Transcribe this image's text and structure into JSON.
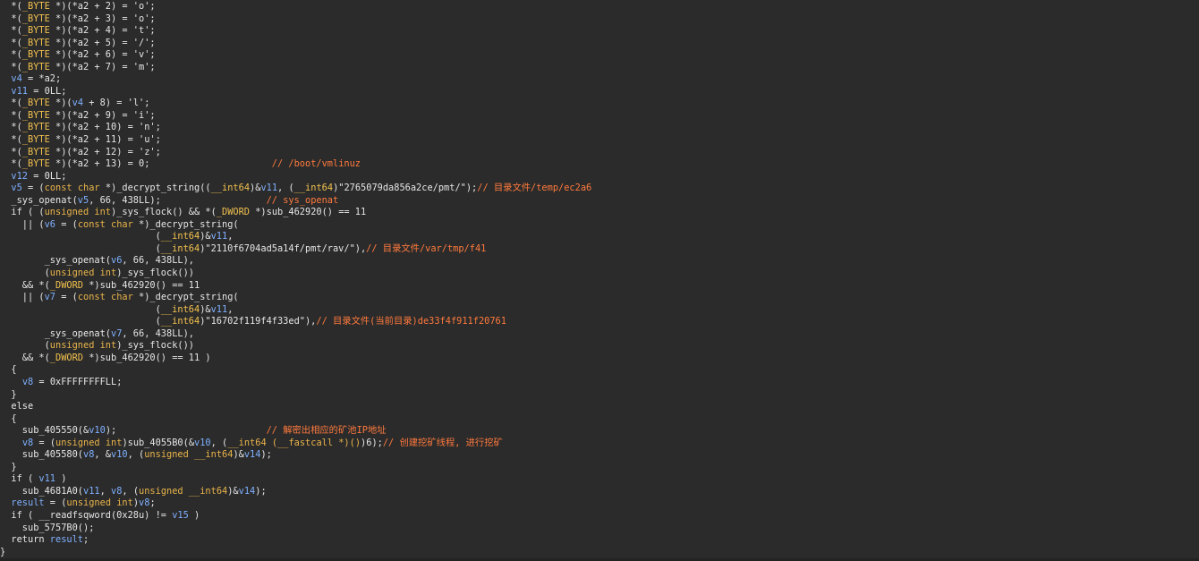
{
  "code_lines": [
    [
      {
        "t": "  *(",
        "c": "tx"
      },
      {
        "t": "_BYTE",
        "c": "ty"
      },
      {
        "t": " *)(*a2 + 2) = 'o';",
        "c": "tx"
      }
    ],
    [
      {
        "t": "  *(",
        "c": "tx"
      },
      {
        "t": "_BYTE",
        "c": "ty"
      },
      {
        "t": " *)(*a2 + 3) = 'o';",
        "c": "tx"
      }
    ],
    [
      {
        "t": "  *(",
        "c": "tx"
      },
      {
        "t": "_BYTE",
        "c": "ty"
      },
      {
        "t": " *)(*a2 + 4) = 't';",
        "c": "tx"
      }
    ],
    [
      {
        "t": "  *(",
        "c": "tx"
      },
      {
        "t": "_BYTE",
        "c": "ty"
      },
      {
        "t": " *)(*a2 + 5) = '/';",
        "c": "tx"
      }
    ],
    [
      {
        "t": "  *(",
        "c": "tx"
      },
      {
        "t": "_BYTE",
        "c": "ty"
      },
      {
        "t": " *)(*a2 + 6) = 'v';",
        "c": "tx"
      }
    ],
    [
      {
        "t": "  *(",
        "c": "tx"
      },
      {
        "t": "_BYTE",
        "c": "ty"
      },
      {
        "t": " *)(*a2 + 7) = 'm';",
        "c": "tx"
      }
    ],
    [
      {
        "t": "  ",
        "c": "tx"
      },
      {
        "t": "v4",
        "c": "var"
      },
      {
        "t": " = *a2;",
        "c": "tx"
      }
    ],
    [
      {
        "t": "  ",
        "c": "tx"
      },
      {
        "t": "v11",
        "c": "var"
      },
      {
        "t": " = 0LL;",
        "c": "tx"
      }
    ],
    [
      {
        "t": "  *(",
        "c": "tx"
      },
      {
        "t": "_BYTE",
        "c": "ty"
      },
      {
        "t": " *)(",
        "c": "tx"
      },
      {
        "t": "v4",
        "c": "var"
      },
      {
        "t": " + 8) = 'l';",
        "c": "tx"
      }
    ],
    [
      {
        "t": "  *(",
        "c": "tx"
      },
      {
        "t": "_BYTE",
        "c": "ty"
      },
      {
        "t": " *)(*a2 + 9) = 'i';",
        "c": "tx"
      }
    ],
    [
      {
        "t": "  *(",
        "c": "tx"
      },
      {
        "t": "_BYTE",
        "c": "ty"
      },
      {
        "t": " *)(*a2 + 10) = 'n';",
        "c": "tx"
      }
    ],
    [
      {
        "t": "  *(",
        "c": "tx"
      },
      {
        "t": "_BYTE",
        "c": "ty"
      },
      {
        "t": " *)(*a2 + 11) = 'u';",
        "c": "tx"
      }
    ],
    [
      {
        "t": "  *(",
        "c": "tx"
      },
      {
        "t": "_BYTE",
        "c": "ty"
      },
      {
        "t": " *)(*a2 + 12) = 'z';",
        "c": "tx"
      }
    ],
    [
      {
        "t": "  *(",
        "c": "tx"
      },
      {
        "t": "_BYTE",
        "c": "ty"
      },
      {
        "t": " *)(*a2 + 13) = 0;                      ",
        "c": "tx"
      },
      {
        "t": "// /boot/vmlinuz",
        "c": "cm"
      }
    ],
    [
      {
        "t": "  ",
        "c": "tx"
      },
      {
        "t": "v12",
        "c": "var"
      },
      {
        "t": " = 0LL;",
        "c": "tx"
      }
    ],
    [
      {
        "t": "  ",
        "c": "tx"
      },
      {
        "t": "v5",
        "c": "var"
      },
      {
        "t": " = (",
        "c": "tx"
      },
      {
        "t": "const char",
        "c": "kw"
      },
      {
        "t": " *)_decrypt_string((",
        "c": "tx"
      },
      {
        "t": "__int64",
        "c": "ty"
      },
      {
        "t": ")&",
        "c": "tx"
      },
      {
        "t": "v11",
        "c": "var"
      },
      {
        "t": ", (",
        "c": "tx"
      },
      {
        "t": "__int64",
        "c": "ty"
      },
      {
        "t": ")\"2765079da856a2ce/pmt/\");",
        "c": "tx"
      },
      {
        "t": "// 目录文件/temp/ec2a6",
        "c": "cm"
      }
    ],
    [
      {
        "t": "  _sys_openat(",
        "c": "tx"
      },
      {
        "t": "v5",
        "c": "var"
      },
      {
        "t": ", 66, 438LL);                   ",
        "c": "tx"
      },
      {
        "t": "// sys_openat",
        "c": "cm"
      }
    ],
    [
      {
        "t": "  if ( (",
        "c": "tx"
      },
      {
        "t": "unsigned int",
        "c": "kw"
      },
      {
        "t": ")_sys_flock() && *(",
        "c": "tx"
      },
      {
        "t": "_DWORD",
        "c": "ty"
      },
      {
        "t": " *)sub_462920() == 11",
        "c": "tx"
      }
    ],
    [
      {
        "t": "    || (",
        "c": "tx"
      },
      {
        "t": "v6",
        "c": "var"
      },
      {
        "t": " = (",
        "c": "tx"
      },
      {
        "t": "const char",
        "c": "kw"
      },
      {
        "t": " *)_decrypt_string(",
        "c": "tx"
      }
    ],
    [
      {
        "t": "                            (",
        "c": "tx"
      },
      {
        "t": "__int64",
        "c": "ty"
      },
      {
        "t": ")&",
        "c": "tx"
      },
      {
        "t": "v11",
        "c": "var"
      },
      {
        "t": ",",
        "c": "tx"
      }
    ],
    [
      {
        "t": "                            (",
        "c": "tx"
      },
      {
        "t": "__int64",
        "c": "ty"
      },
      {
        "t": ")\"2110f6704ad5a14f/pmt/rav/\"),",
        "c": "tx"
      },
      {
        "t": "// 目录文件/var/tmp/f41",
        "c": "cm"
      }
    ],
    [
      {
        "t": "        _sys_openat(",
        "c": "tx"
      },
      {
        "t": "v6",
        "c": "var"
      },
      {
        "t": ", 66, 438LL),",
        "c": "tx"
      }
    ],
    [
      {
        "t": "        (",
        "c": "tx"
      },
      {
        "t": "unsigned int",
        "c": "kw"
      },
      {
        "t": ")_sys_flock())",
        "c": "tx"
      }
    ],
    [
      {
        "t": "    && *(",
        "c": "tx"
      },
      {
        "t": "_DWORD",
        "c": "ty"
      },
      {
        "t": " *)sub_462920() == 11",
        "c": "tx"
      }
    ],
    [
      {
        "t": "    || (",
        "c": "tx"
      },
      {
        "t": "v7",
        "c": "var"
      },
      {
        "t": " = (",
        "c": "tx"
      },
      {
        "t": "const char",
        "c": "kw"
      },
      {
        "t": " *)_decrypt_string(",
        "c": "tx"
      }
    ],
    [
      {
        "t": "                            (",
        "c": "tx"
      },
      {
        "t": "__int64",
        "c": "ty"
      },
      {
        "t": ")&",
        "c": "tx"
      },
      {
        "t": "v11",
        "c": "var"
      },
      {
        "t": ",",
        "c": "tx"
      }
    ],
    [
      {
        "t": "                            (",
        "c": "tx"
      },
      {
        "t": "__int64",
        "c": "ty"
      },
      {
        "t": ")\"16702f119f4f33ed\"),",
        "c": "tx"
      },
      {
        "t": "// 目录文件(当前目录)de33f4f911f20761",
        "c": "cm"
      }
    ],
    [
      {
        "t": "        _sys_openat(",
        "c": "tx"
      },
      {
        "t": "v7",
        "c": "var"
      },
      {
        "t": ", 66, 438LL),",
        "c": "tx"
      }
    ],
    [
      {
        "t": "        (",
        "c": "tx"
      },
      {
        "t": "unsigned int",
        "c": "kw"
      },
      {
        "t": ")_sys_flock())",
        "c": "tx"
      }
    ],
    [
      {
        "t": "    && *(",
        "c": "tx"
      },
      {
        "t": "_DWORD",
        "c": "ty"
      },
      {
        "t": " *)sub_462920() == 11 )",
        "c": "tx"
      }
    ],
    [
      {
        "t": "  {",
        "c": "tx"
      }
    ],
    [
      {
        "t": "    ",
        "c": "tx"
      },
      {
        "t": "v8",
        "c": "var"
      },
      {
        "t": " = 0xFFFFFFFFLL;",
        "c": "tx"
      }
    ],
    [
      {
        "t": "  }",
        "c": "tx"
      }
    ],
    [
      {
        "t": "  else",
        "c": "tx"
      }
    ],
    [
      {
        "t": "  {",
        "c": "tx"
      }
    ],
    [
      {
        "t": "    sub_405550(&",
        "c": "tx"
      },
      {
        "t": "v10",
        "c": "var"
      },
      {
        "t": ");                           ",
        "c": "tx"
      },
      {
        "t": "// 解密出相应的矿池IP地址",
        "c": "cm"
      }
    ],
    [
      {
        "t": "    ",
        "c": "tx"
      },
      {
        "t": "v8",
        "c": "var"
      },
      {
        "t": " = (",
        "c": "tx"
      },
      {
        "t": "unsigned int",
        "c": "kw"
      },
      {
        "t": ")sub_4055B0(&",
        "c": "tx"
      },
      {
        "t": "v10",
        "c": "var"
      },
      {
        "t": ", (",
        "c": "tx"
      },
      {
        "t": "__int64 (__fastcall *)()",
        "c": "kw"
      },
      {
        "t": ")6);",
        "c": "tx"
      },
      {
        "t": "// 创建挖矿线程, 进行挖矿",
        "c": "cm"
      }
    ],
    [
      {
        "t": "    sub_405580(",
        "c": "tx"
      },
      {
        "t": "v8",
        "c": "var"
      },
      {
        "t": ", &",
        "c": "tx"
      },
      {
        "t": "v10",
        "c": "var"
      },
      {
        "t": ", (",
        "c": "tx"
      },
      {
        "t": "unsigned __int64",
        "c": "kw"
      },
      {
        "t": ")&",
        "c": "tx"
      },
      {
        "t": "v14",
        "c": "var"
      },
      {
        "t": ");",
        "c": "tx"
      }
    ],
    [
      {
        "t": "  }",
        "c": "tx"
      }
    ],
    [
      {
        "t": "  if ( ",
        "c": "tx"
      },
      {
        "t": "v11",
        "c": "var"
      },
      {
        "t": " )",
        "c": "tx"
      }
    ],
    [
      {
        "t": "    sub_4681A0(",
        "c": "tx"
      },
      {
        "t": "v11",
        "c": "var"
      },
      {
        "t": ", ",
        "c": "tx"
      },
      {
        "t": "v8",
        "c": "var"
      },
      {
        "t": ", (",
        "c": "tx"
      },
      {
        "t": "unsigned __int64",
        "c": "kw"
      },
      {
        "t": ")&",
        "c": "tx"
      },
      {
        "t": "v14",
        "c": "var"
      },
      {
        "t": ");",
        "c": "tx"
      }
    ],
    [
      {
        "t": "  ",
        "c": "tx"
      },
      {
        "t": "result",
        "c": "var"
      },
      {
        "t": " = (",
        "c": "tx"
      },
      {
        "t": "unsigned int",
        "c": "kw"
      },
      {
        "t": ")",
        "c": "tx"
      },
      {
        "t": "v8",
        "c": "var"
      },
      {
        "t": ";",
        "c": "tx"
      }
    ],
    [
      {
        "t": "  if ( __readfsqword(0x28u) != ",
        "c": "tx"
      },
      {
        "t": "v15",
        "c": "var"
      },
      {
        "t": " )",
        "c": "tx"
      }
    ],
    [
      {
        "t": "    sub_5757B0();",
        "c": "tx"
      }
    ],
    [
      {
        "t": "  return ",
        "c": "tx"
      },
      {
        "t": "result",
        "c": "var"
      },
      {
        "t": ";",
        "c": "tx"
      }
    ],
    [
      {
        "t": "}",
        "c": "tx"
      }
    ]
  ]
}
